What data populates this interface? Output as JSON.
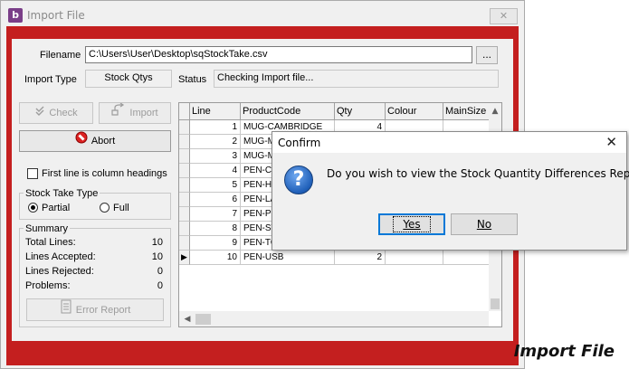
{
  "window": {
    "title": "Import File",
    "close_glyph": "✕",
    "footer": "Import File",
    "frame_color": "#c41f1f"
  },
  "form": {
    "filename_label": "Filename",
    "filename_value": "C:\\Users\\User\\Desktop\\sqStockTake.csv",
    "browse_label": "...",
    "import_type_label": "Import Type",
    "import_type_value": "Stock Qtys",
    "status_label": "Status",
    "status_value": "Checking Import file..."
  },
  "buttons": {
    "check": "Check",
    "import": "Import",
    "abort": "Abort",
    "error_report": "Error Report"
  },
  "options": {
    "first_line_headings": "First line is column headings",
    "first_line_checked": false,
    "stock_take_type_title": "Stock Take Type",
    "partial": "Partial",
    "full": "Full",
    "selected": "Partial"
  },
  "summary": {
    "title": "Summary",
    "rows": [
      {
        "label": "Total Lines:",
        "value": "10"
      },
      {
        "label": "Lines Accepted:",
        "value": "10"
      },
      {
        "label": "Lines Rejected:",
        "value": "0"
      },
      {
        "label": "Problems:",
        "value": "0"
      }
    ]
  },
  "grid": {
    "columns": [
      "Line",
      "ProductCode",
      "Qty",
      "Colour",
      "MainSize"
    ],
    "rows": [
      {
        "line": "1",
        "code": "MUG-CAMBRIDGE",
        "qty": "4"
      },
      {
        "line": "2",
        "code": "MUG-M",
        "qty": ""
      },
      {
        "line": "3",
        "code": "MUG-M",
        "qty": ""
      },
      {
        "line": "4",
        "code": "PEN-CO",
        "qty": ""
      },
      {
        "line": "5",
        "code": "PEN-HI",
        "qty": ""
      },
      {
        "line": "6",
        "code": "PEN-LA",
        "qty": ""
      },
      {
        "line": "7",
        "code": "PEN-PE",
        "qty": ""
      },
      {
        "line": "8",
        "code": "PEN-ST",
        "qty": ""
      },
      {
        "line": "9",
        "code": "PEN-TO",
        "qty": ""
      },
      {
        "line": "10",
        "code": "PEN-USB",
        "qty": "2"
      }
    ],
    "current_row_marker": "▶"
  },
  "dialog": {
    "title": "Confirm",
    "close_glyph": "✕",
    "icon_glyph": "?",
    "message": "Do you wish to view the Stock Quantity Differences Report?",
    "yes": "Yes",
    "no": "No"
  }
}
